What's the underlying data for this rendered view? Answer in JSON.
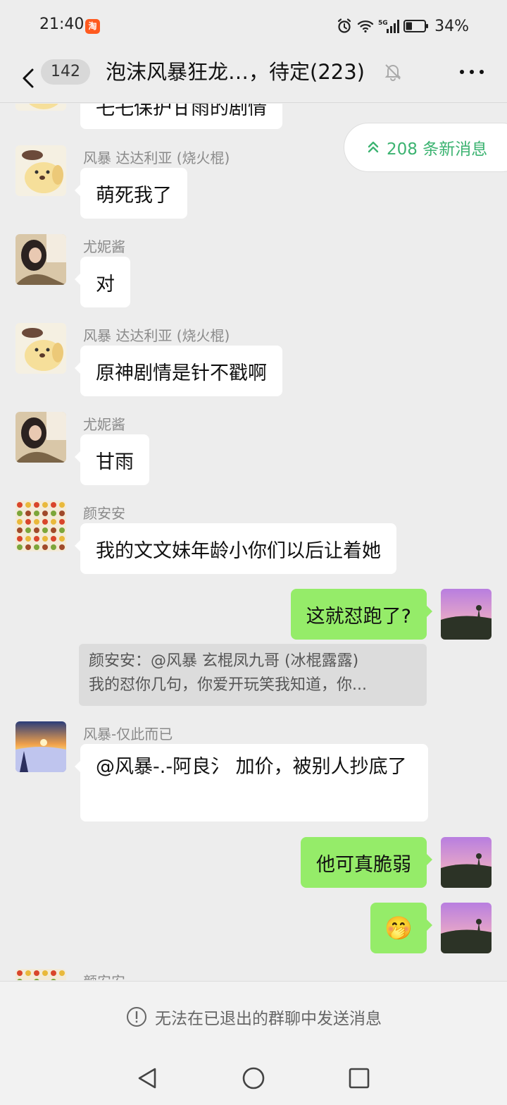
{
  "status_bar": {
    "time": "21:40",
    "app_icon": "taobao-icon",
    "app_icon_glyph": "淘",
    "icons": [
      "alarm-icon",
      "wifi-icon",
      "signal-5g-icon",
      "battery-icon"
    ],
    "network_label": "5G",
    "battery_percent": "34%",
    "battery_level": 0.34
  },
  "nav": {
    "unread_count": "142",
    "title": "泡沫风暴狂龙…，待定(223)",
    "mute_icon": "bell-muted-icon",
    "more_icon": "more-icon"
  },
  "new_messages_pill": {
    "label": "208 条新消息",
    "icon": "double-chevron-up-icon",
    "color": "#3cb371"
  },
  "messages": [
    {
      "type": "text",
      "side": "left",
      "text": "乇乇保护甘雨的剧情",
      "partial": true
    },
    {
      "type": "text",
      "side": "left",
      "sender": "风暴 达达利亚 (烧火棍)",
      "avatar": "dog-avatar",
      "text": "萌死我了"
    },
    {
      "type": "text",
      "side": "left",
      "sender": "尤妮酱",
      "avatar": "girl-avatar",
      "text": "对"
    },
    {
      "type": "text",
      "side": "left",
      "sender": "风暴 达达利亚 (烧火棍)",
      "avatar": "dog-avatar",
      "text": "原神剧情是针不戳啊"
    },
    {
      "type": "text",
      "side": "left",
      "sender": "尤妮酱",
      "avatar": "girl-avatar",
      "text": "甘雨"
    },
    {
      "type": "text",
      "side": "left",
      "sender": "颜安安",
      "avatar": "fruit-grid-avatar",
      "text": "我的文文妹年龄小你们以后让着她"
    },
    {
      "type": "text",
      "side": "right",
      "avatar": "sunset-avatar",
      "text": "这就怼跑了?",
      "quote": {
        "line1": "颜安安：@风暴  玄棍凤九哥 (冰棍露露)",
        "line2": "我的怼你几句，你爱开玩笑我知道，你..."
      }
    },
    {
      "type": "text",
      "side": "left",
      "sender": "风暴-仅此而已",
      "avatar": "snow-sunset-avatar",
      "text": "@风暴-.-阿良氵  加价，被别人抄底了"
    },
    {
      "type": "text",
      "side": "right",
      "avatar": "sunset-avatar",
      "text": "他可真脆弱"
    },
    {
      "type": "emoji",
      "side": "right",
      "avatar": "sunset-avatar",
      "emoji": "🤭"
    },
    {
      "type": "partial",
      "side": "left",
      "sender": "颜安安",
      "avatar": "fruit-grid-avatar"
    }
  ],
  "bottom_notice": {
    "icon": "info-circle-icon",
    "text": "无法在已退出的群聊中发送消息"
  },
  "android_nav": [
    "back-triangle-icon",
    "home-circle-icon",
    "recents-square-icon"
  ],
  "colors": {
    "background": "#ededed",
    "bubble_self": "#95ec69",
    "bubble_other": "#ffffff"
  }
}
